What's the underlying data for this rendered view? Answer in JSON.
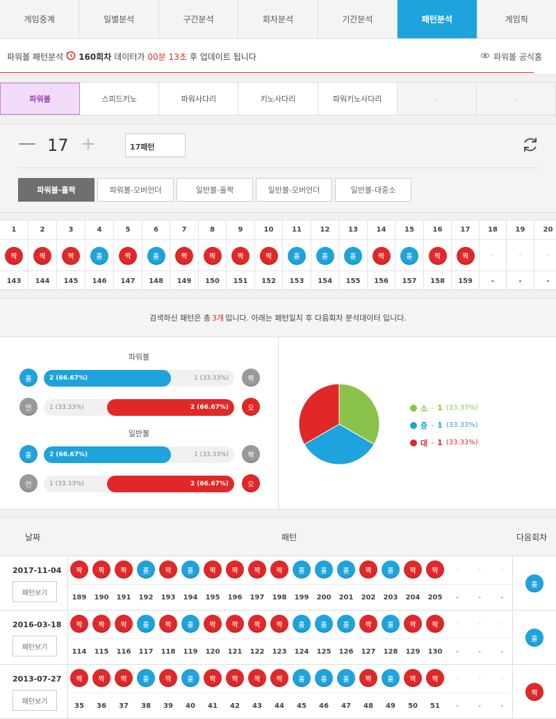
{
  "nav": {
    "tabs": [
      "게임중계",
      "일별분석",
      "구간분석",
      "회차분석",
      "기간분석",
      "패턴분석",
      "게임픽"
    ],
    "active": 5
  },
  "info": {
    "prefix": "파워볼 패턴분석",
    "round": "160회차",
    "middle": "데이터가",
    "time": "00분 13초",
    "suffix": "후 업데이트 됩니다",
    "home": "파워볼 공식홈"
  },
  "game_tabs": {
    "tabs": [
      "파워볼",
      "스피드키노",
      "파워사다리",
      "키노사다리",
      "파워키노사다리",
      "-",
      "-"
    ],
    "active": 0
  },
  "control": {
    "count": "17",
    "pattern_input": "17패턴",
    "pattern_tabs": [
      "파워볼-홀짝",
      "파워볼-오버언더",
      "일반볼-홀짝",
      "일반볼-오버언더",
      "일반볼-대중소"
    ],
    "active": 0
  },
  "sequence": {
    "numbers": [
      "1",
      "2",
      "3",
      "4",
      "5",
      "6",
      "7",
      "8",
      "9",
      "10",
      "11",
      "12",
      "13",
      "14",
      "15",
      "16",
      "17",
      "18",
      "19",
      "20"
    ],
    "balls": [
      "짝",
      "짝",
      "짝",
      "홀",
      "짝",
      "홀",
      "짝",
      "짝",
      "짝",
      "짝",
      "홀",
      "홀",
      "홀",
      "짝",
      "홀",
      "짝",
      "짝",
      "-",
      "-",
      "-"
    ],
    "rounds": [
      "143",
      "144",
      "145",
      "146",
      "147",
      "148",
      "149",
      "150",
      "151",
      "152",
      "153",
      "154",
      "155",
      "156",
      "157",
      "158",
      "159",
      "-",
      "-",
      "-"
    ]
  },
  "result": {
    "before": "검색하신 패턴은 총",
    "count": "3개",
    "after": "입니다. 아래는 패턴일치 후 다음회차 분석데이터 입니다."
  },
  "stats": {
    "powerball_title": "파워볼",
    "normal_title": "일반볼",
    "rows": [
      {
        "left": "홀",
        "right": "짝",
        "fill": "2 (66.67%)",
        "rest": "1 (33.33%)",
        "fill_side": "left",
        "fraction": 0.6667
      },
      {
        "left": "언",
        "right": "오",
        "fill": "2 (66.67%)",
        "rest": "1 (33.33%)",
        "fill_side": "right",
        "fraction": 0.6667
      },
      {
        "left": "홀",
        "right": "짝",
        "fill": "2 (66.67%)",
        "rest": "1 (33.33%)",
        "fill_side": "left",
        "fraction": 0.6667
      },
      {
        "left": "언",
        "right": "오",
        "fill": "2 (66.67%)",
        "rest": "1 (33.33%)",
        "fill_side": "right",
        "fraction": 0.6667
      }
    ],
    "pie": [
      {
        "label": "소",
        "count": "1",
        "pct": "(33.33%)",
        "value": 1,
        "color": "#8bc34a"
      },
      {
        "label": "중",
        "count": "1",
        "pct": "(33.33%)",
        "value": 1,
        "color": "#1ea3dc"
      },
      {
        "label": "대",
        "count": "1",
        "pct": "(33.33%)",
        "value": 1,
        "color": "#e02828"
      }
    ]
  },
  "history": {
    "head_date": "날짜",
    "head_pattern": "패턴",
    "head_next": "다음회차",
    "view_label": "패턴보기",
    "rows": [
      {
        "date": "2017-11-04",
        "balls": [
          "짝",
          "짝",
          "짝",
          "홀",
          "짝",
          "홀",
          "짝",
          "짝",
          "짝",
          "짝",
          "홀",
          "홀",
          "홀",
          "짝",
          "홀",
          "짝",
          "짝"
        ],
        "rounds": [
          "189",
          "190",
          "191",
          "192",
          "193",
          "194",
          "195",
          "196",
          "197",
          "198",
          "199",
          "200",
          "201",
          "202",
          "203",
          "204",
          "205"
        ],
        "next": "홀"
      },
      {
        "date": "2016-03-18",
        "balls": [
          "짝",
          "짝",
          "짝",
          "홀",
          "짝",
          "홀",
          "짝",
          "짝",
          "짝",
          "짝",
          "홀",
          "홀",
          "홀",
          "짝",
          "홀",
          "짝",
          "짝"
        ],
        "rounds": [
          "114",
          "115",
          "116",
          "117",
          "118",
          "119",
          "120",
          "121",
          "122",
          "123",
          "124",
          "125",
          "126",
          "127",
          "128",
          "129",
          "130"
        ],
        "next": "홀"
      },
      {
        "date": "2013-07-27",
        "balls": [
          "짝",
          "짝",
          "짝",
          "홀",
          "짝",
          "홀",
          "짝",
          "짝",
          "짝",
          "짝",
          "홀",
          "홀",
          "홀",
          "짝",
          "홀",
          "짝",
          "짝"
        ],
        "rounds": [
          "35",
          "36",
          "37",
          "38",
          "39",
          "40",
          "41",
          "42",
          "43",
          "44",
          "45",
          "46",
          "47",
          "48",
          "49",
          "50",
          "51"
        ],
        "next": "짝"
      }
    ]
  },
  "colors": {
    "accent": "#1ea3dc",
    "odd": "#1ea3dc",
    "even": "#e02828",
    "sub_active": "#f2dcf7"
  }
}
